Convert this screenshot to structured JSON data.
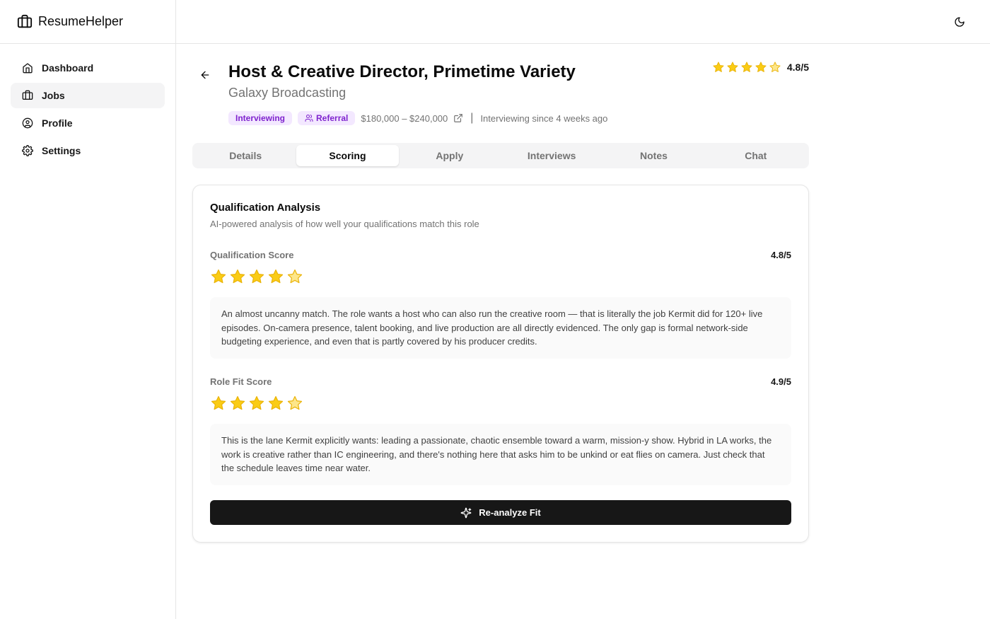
{
  "app": {
    "name": "ResumeHelper"
  },
  "sidebar": {
    "items": [
      {
        "label": "Dashboard",
        "icon": "home-icon"
      },
      {
        "label": "Jobs",
        "icon": "briefcase-icon",
        "active": true
      },
      {
        "label": "Profile",
        "icon": "user-circle-icon"
      },
      {
        "label": "Settings",
        "icon": "gear-icon"
      }
    ]
  },
  "topbar": {
    "theme_icon": "moon-icon"
  },
  "job": {
    "title": "Host & Creative Director, Primetime Variety",
    "company": "Galaxy Broadcasting",
    "rating": 4.8,
    "rating_label": "4.8/5",
    "status_badge": "Interviewing",
    "referral_badge": "Referral",
    "salary": "$180,000 – $240,000",
    "since": "Interviewing since 4 weeks ago"
  },
  "tabs": [
    {
      "label": "Details"
    },
    {
      "label": "Scoring",
      "active": true
    },
    {
      "label": "Apply"
    },
    {
      "label": "Interviews"
    },
    {
      "label": "Notes"
    },
    {
      "label": "Chat"
    }
  ],
  "analysis": {
    "title": "Qualification Analysis",
    "subtitle": "AI-powered analysis of how well your qualifications match this role",
    "qualification": {
      "label": "Qualification Score",
      "score": 4.8,
      "score_label": "4.8/5",
      "text": "An almost uncanny match. The role wants a host who can also run the creative room — that is literally the job Kermit did for 120+ live episodes. On-camera presence, talent booking, and live production are all directly evidenced. The only gap is formal network-side budgeting experience, and even that is partly covered by his producer credits."
    },
    "role_fit": {
      "label": "Role Fit Score",
      "score": 4.9,
      "score_label": "4.9/5",
      "text": "This is the lane Kermit explicitly wants: leading a passionate, chaotic ensemble toward a warm, mission-y show. Hybrid in LA works, the work is creative rather than IC engineering, and there's nothing here that asks him to be unkind or eat flies on camera. Just check that the schedule leaves time near water."
    },
    "button_label": "Re-analyze Fit"
  },
  "colors": {
    "star_fill": "#facc15",
    "star_stroke": "#eab308",
    "badge_bg": "#f3e8ff",
    "badge_text": "#7e22ce",
    "button_bg": "#171717"
  }
}
